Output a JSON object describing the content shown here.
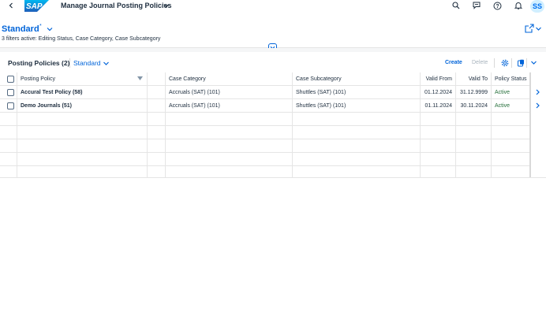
{
  "shell": {
    "logo_text": "SAP",
    "app_title": "Manage Journal Posting Policies",
    "avatar_initials": "SS",
    "icons": [
      "back-icon",
      "search-icon",
      "feedback-icon",
      "help-icon",
      "notifications-icon"
    ]
  },
  "header": {
    "variant_name": "Standard",
    "variant_modified_marker": "*",
    "filters_summary": "3 filters active: Editing Status, Case Category, Case Subcategory"
  },
  "table_toolbar": {
    "title": "Posting Policies (2)",
    "variant": "Standard",
    "create_label": "Create",
    "delete_label": "Delete"
  },
  "table": {
    "columns": [
      "Posting Policy",
      "Case Category",
      "Case Subcategory",
      "Valid From",
      "Valid To",
      "Policy Status"
    ],
    "rows": [
      {
        "policy": "Accural Test Policy (58)",
        "category": "Accruals (SAT) (101)",
        "subcategory": "Shuttles (SAT) (101)",
        "valid_from": "01.12.2024",
        "valid_to": "31.12.9999",
        "status": "Active"
      },
      {
        "policy": "Demo Journals (51)",
        "category": "Accruals (SAT) (101)",
        "subcategory": "Shuttles (SAT) (101)",
        "valid_from": "01.11.2024",
        "valid_to": "30.11.2024",
        "status": "Active"
      }
    ]
  },
  "colors": {
    "brand_blue": "#0064d9",
    "status_positive": "#256f3a",
    "text": "#1d2d3e"
  }
}
